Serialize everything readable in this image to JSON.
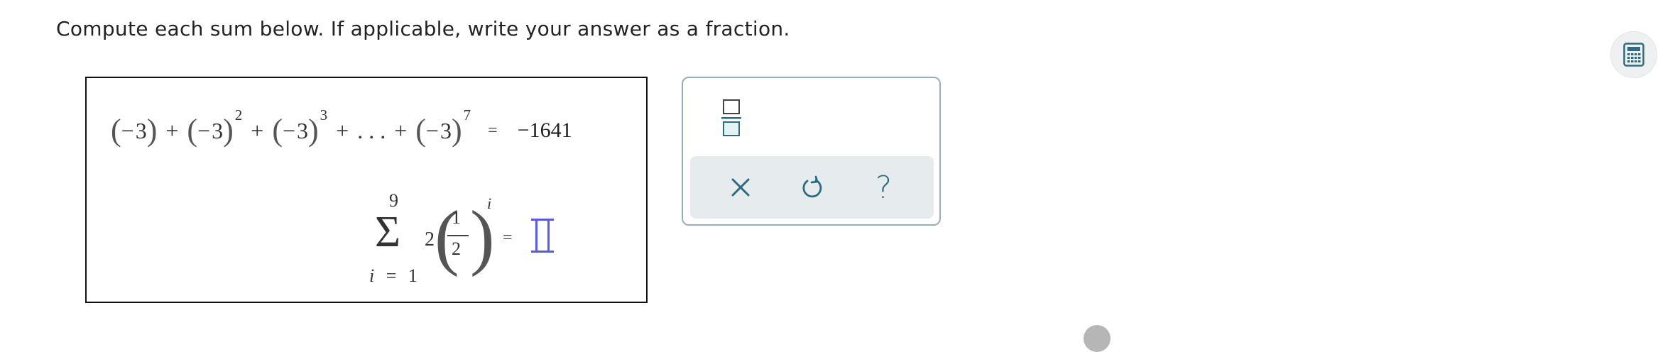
{
  "instructions": "Compute each sum below. If applicable, write your answer as a fraction.",
  "problem1": {
    "base_neg": "−",
    "base": "3",
    "open_paren": "(",
    "close_paren": ")",
    "plus": "+",
    "exp2": "2",
    "exp3": "3",
    "ellipsis": ". . .",
    "exp_last": "7",
    "equals": "=",
    "answer": "−1641"
  },
  "problem2": {
    "upper_limit": "9",
    "sigma": "Σ",
    "lower_limit_var": "i",
    "lower_limit_eq": "=",
    "lower_limit_val": "1",
    "coefficient": "2",
    "frac_num": "1",
    "frac_den": "2",
    "left_paren": "(",
    "right_paren": ")",
    "exponent": "i",
    "equals": "=",
    "answer_value": ""
  },
  "toolbar": {
    "fraction_icon": "fraction-template-icon",
    "clear_icon": "x-icon",
    "undo_icon": "undo-icon",
    "help_glyph": "?"
  },
  "colors": {
    "accent": "#2d6b80",
    "cursor": "#5a5ae0",
    "toolbar_bg": "#e6ebee"
  }
}
